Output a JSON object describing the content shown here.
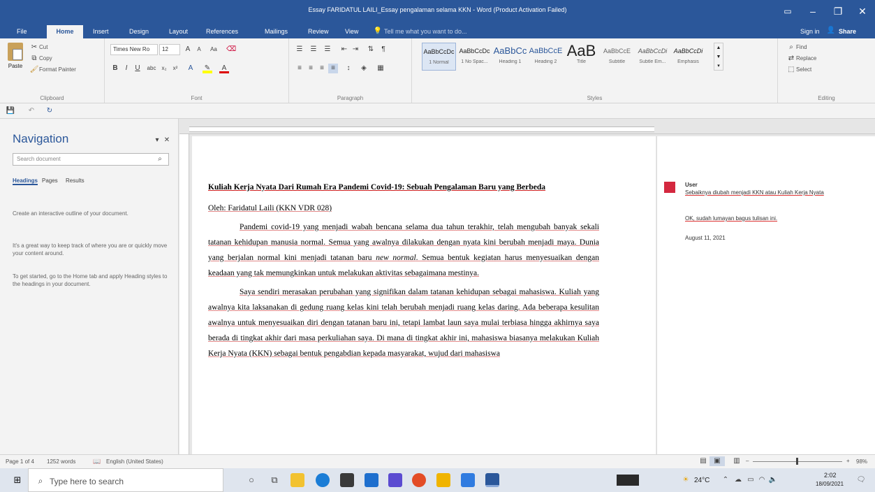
{
  "window": {
    "title": "Essay FARIDATUL LAILI_Essay pengalaman selama KKN - Word (Product Activation Failed)"
  },
  "tabs": [
    "File",
    "Home",
    "Insert",
    "Design",
    "Layout",
    "References",
    "Mailings",
    "Review",
    "View"
  ],
  "tellme": "Tell me what you want to do...",
  "account": {
    "signin": "Sign in",
    "share": "Share"
  },
  "ribbon": {
    "clipboard": {
      "label": "Clipboard",
      "paste": "Paste",
      "cut": "Cut",
      "copy": "Copy",
      "format_painter": "Format Painter"
    },
    "font": {
      "label": "Font",
      "name": "Times New Ro",
      "size": "12"
    },
    "paragraph": {
      "label": "Paragraph"
    },
    "styles": {
      "label": "Styles",
      "items": [
        {
          "preview": "AaBbCcDc",
          "name": "1 Normal"
        },
        {
          "preview": "AaBbCcDc",
          "name": "1 No Spac..."
        },
        {
          "preview": "AaBbCc",
          "name": "Heading 1"
        },
        {
          "preview": "AaBbCcE",
          "name": "Heading 2"
        },
        {
          "preview": "AaB",
          "name": "Title"
        },
        {
          "preview": "AaBbCcE",
          "name": "Subtitle"
        },
        {
          "preview": "AaBbCcDi",
          "name": "Subtle Em..."
        },
        {
          "preview": "AaBbCcDi",
          "name": "Emphasis"
        }
      ]
    },
    "editing": {
      "label": "Editing",
      "find": "Find",
      "replace": "Replace",
      "select": "Select"
    }
  },
  "navigation": {
    "title": "Navigation",
    "search_placeholder": "Search document",
    "tabs": [
      "Headings",
      "Pages",
      "Results"
    ],
    "p1": "Create an interactive outline of your document.",
    "p2": "It's a great way to keep track of where you are or quickly move your content around.",
    "p3": "To get started, go to the Home tab and apply Heading styles to the headings in your document."
  },
  "document": {
    "title": "Kuliah Kerja Nyata Dari Rumah Era Pandemi Covid-19: Sebuah Pengalaman Baru yang Berbeda",
    "byline": "Oleh: Faridatul Laili (KKN VDR 028)",
    "para1_pre": "Pandemi covid-19 yang menjadi wabah bencana selama dua tahun terakhir, telah mengubah banyak sekali tatanan kehidupan manusia normal. Semua yang awalnya dilakukan dengan nyata kini berubah menjadi maya. Dunia yang berjalan normal kini menjadi tatanan baru ",
    "para1_em": "new normal",
    "para1_post": ". Semua bentuk kegiatan harus menyesuaikan dengan keadaan yang tak memungkinkan untuk melakukan aktivitas sebagaimana mestinya.",
    "para2": "Saya sendiri merasakan perubahan yang signifikan dalam tatanan kehidupan sebagai mahasiswa. Kuliah yang awalnya kita laksanakan di gedung ruang kelas kini telah berubah menjadi ruang kelas daring. Ada beberapa kesulitan awalnya untuk menyesuaikan diri dengan tatanan baru ini, tetapi lambat laun saya mulai terbiasa hingga akhirnya saya berada di tingkat akhir dari masa perkuliahan saya. Di mana di tingkat akhir ini, mahasiswa biasanya melakukan Kuliah Kerja Nyata (KKN) sebagai bentuk pengabdian kepada masyarakat, wujud dari mahasiswa"
  },
  "comment": {
    "author": "User",
    "text": "Sebaiknya diubah menjadi KKN atau Kuliah Kerja Nyata",
    "reply": "OK, sudah lumayan bagus tulisan ini.",
    "date": "August 11, 2021"
  },
  "status": {
    "page": "Page 1 of 4",
    "words": "1252 words",
    "language": "English (United States)",
    "zoom": "98%"
  },
  "taskbar": {
    "search_placeholder": "Type here to search",
    "weather": "24°C",
    "time": "2:02",
    "date": "18/09/2021"
  }
}
